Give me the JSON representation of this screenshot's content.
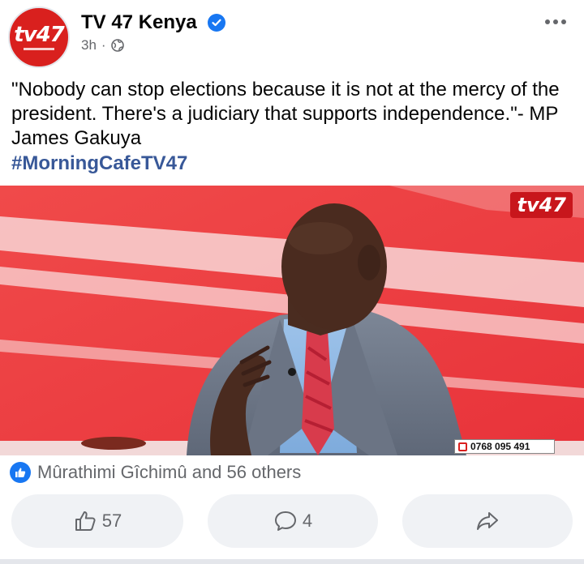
{
  "post": {
    "page_name": "TV 47 Kenya",
    "time": "3h",
    "separator": "·",
    "logo_text": "tv47",
    "text": "\"Nobody can stop elections because it is not at the mercy of the president. There's a judiciary that supports independence.\"- MP James Gakuya",
    "hashtag": "#MorningCafeTV47"
  },
  "media": {
    "watermark": "tv47",
    "phone": "0768 095 491"
  },
  "reactions": {
    "summary": "Mûrathimi Gîchimû and 56 others"
  },
  "actions": {
    "like_count": "57",
    "comment_count": "4"
  },
  "icons": {
    "verified": "verified-badge-icon",
    "audience": "globe-icon",
    "more": "more-options-icon",
    "like": "thumbs-up-icon",
    "comment": "comment-icon",
    "share": "share-icon"
  },
  "colors": {
    "brand_red": "#d9201e",
    "facebook_blue": "#1877f2",
    "hashtag": "#385898",
    "muted": "#65676b"
  }
}
